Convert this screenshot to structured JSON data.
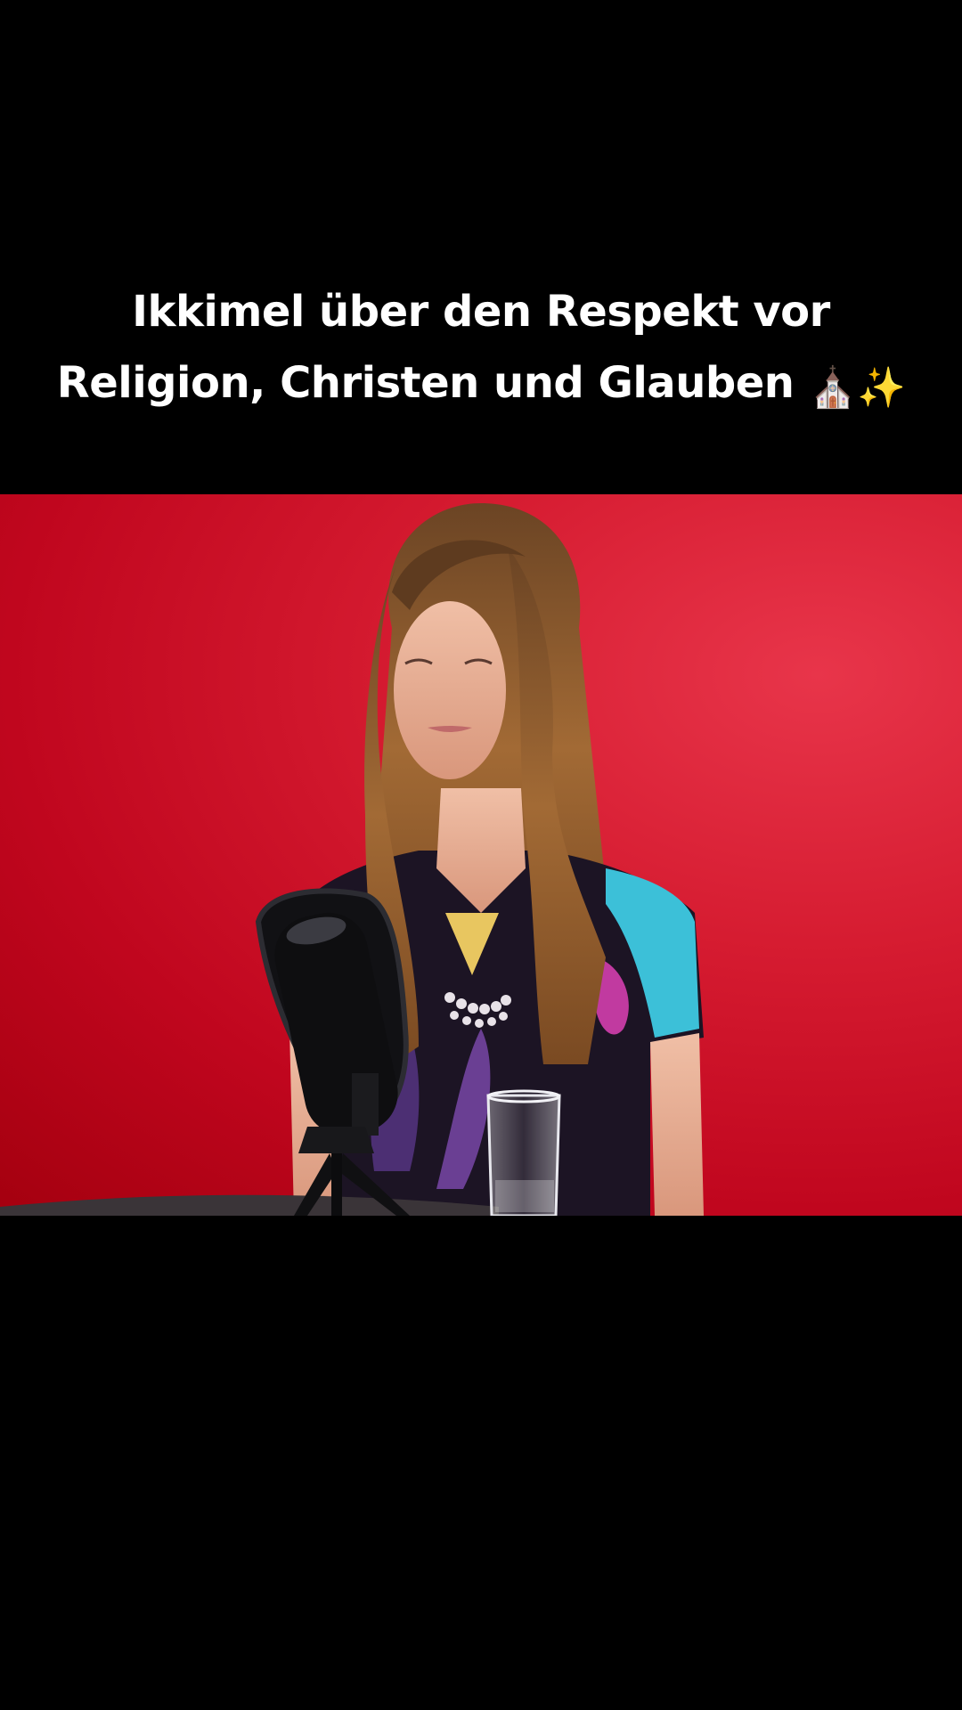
{
  "caption": {
    "line1": "Ikkimel über den Respekt vor",
    "line2": "Religion, Christen und Glauben",
    "emojis": "⛪✨"
  },
  "video": {
    "background_color": "#d61c31",
    "scene": "podcast-interview"
  }
}
